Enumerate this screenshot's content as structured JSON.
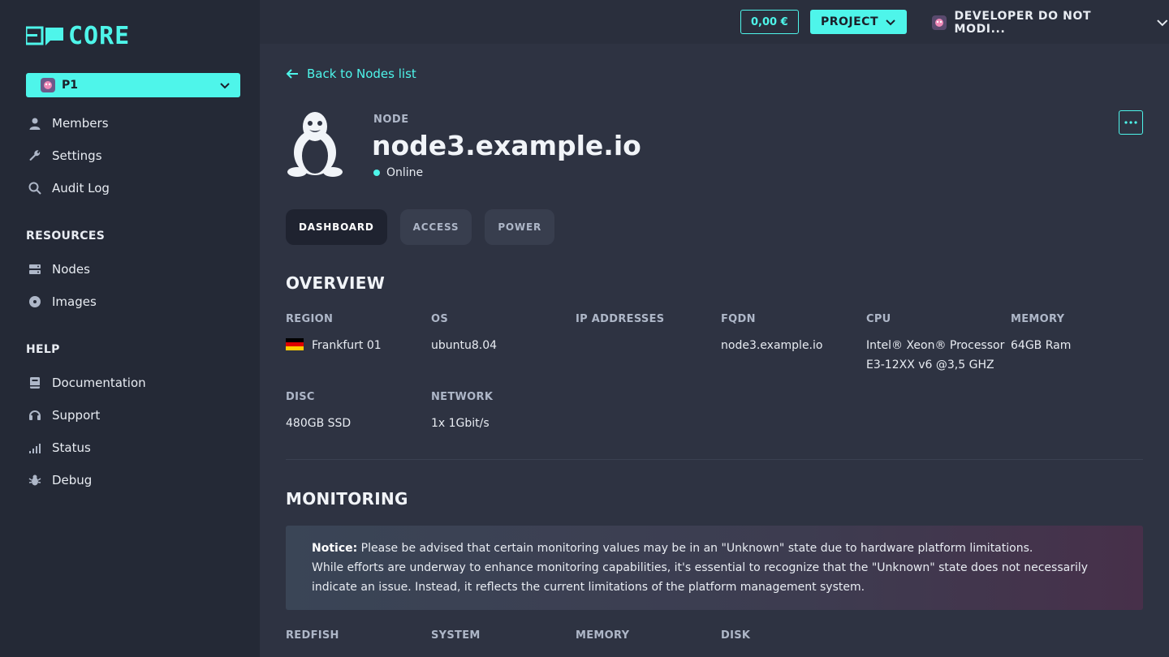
{
  "app": {
    "logo_text": "CORE"
  },
  "sidebar": {
    "project": {
      "name": "P1"
    },
    "items_top": [
      {
        "label": "Members",
        "icon": "user-icon"
      },
      {
        "label": "Settings",
        "icon": "wrench-icon"
      },
      {
        "label": "Audit Log",
        "icon": "search-icon"
      }
    ],
    "resources_title": "RESOURCES",
    "resources": [
      {
        "label": "Nodes",
        "icon": "server-icon"
      },
      {
        "label": "Images",
        "icon": "disc-icon"
      }
    ],
    "help_title": "HELP",
    "help": [
      {
        "label": "Documentation",
        "icon": "book-icon"
      },
      {
        "label": "Support",
        "icon": "headset-icon"
      },
      {
        "label": "Status",
        "icon": "signal-icon"
      },
      {
        "label": "Debug",
        "icon": "bug-icon"
      }
    ]
  },
  "topbar": {
    "balance": "0,00 €",
    "project_label": "PROJECT",
    "user_label": "DEVELOPER DO NOT MODI..."
  },
  "node": {
    "back_label": "Back to Nodes list",
    "label": "NODE",
    "name": "node3.example.io",
    "status": "Online"
  },
  "tabs": [
    {
      "label": "DASHBOARD",
      "active": true
    },
    {
      "label": "ACCESS",
      "active": false
    },
    {
      "label": "POWER",
      "active": false
    }
  ],
  "overview": {
    "title": "OVERVIEW",
    "region_label": "REGION",
    "region_value": "Frankfurt 01",
    "os_label": "OS",
    "os_value": "ubuntu8.04",
    "ip_label": "IP ADDRESSES",
    "ip_value": "",
    "fqdn_label": "FQDN",
    "fqdn_value": "node3.example.io",
    "cpu_label": "CPU",
    "cpu_value_line1": "Intel® Xeon® Processor",
    "cpu_value_line2": "E3-12XX v6 @3,5 GHZ",
    "memory_label": "MEMORY",
    "memory_value": "64GB Ram",
    "disc_label": "DISC",
    "disc_value": "480GB SSD",
    "network_label": "NETWORK",
    "network_value": "1x 1Gbit/s"
  },
  "monitoring": {
    "title": "MONITORING",
    "notice_bold": "Notice:",
    "notice_line1": "Please be advised that certain monitoring values may be in an \"Unknown\" state due to hardware platform limitations.",
    "notice_line2": "While efforts are underway to enhance monitoring capabilities, it's essential to recognize that the \"Unknown\" state does not necessarily indicate an issue. Instead, it reflects the current limitations of the platform management system.",
    "columns": [
      "REDFISH",
      "SYSTEM",
      "MEMORY",
      "DISK"
    ]
  },
  "colors": {
    "accent": "#4ef5ea",
    "sidebar_bg": "#242936",
    "main_bg": "#2e3342"
  }
}
